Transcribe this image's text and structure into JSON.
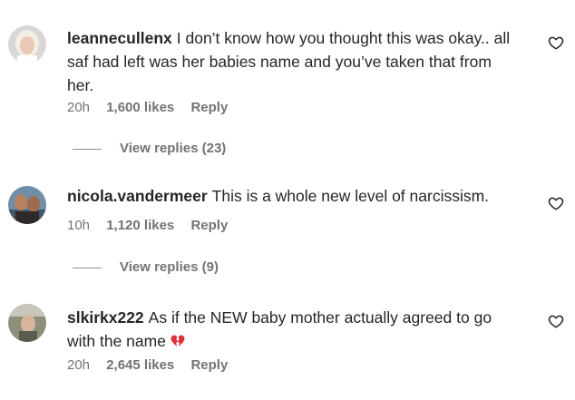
{
  "comments": [
    {
      "username": "leannecullenx",
      "text": "I don’t know how you thought this was okay.. all saf had left was her babies name and you’ve taken that from her.",
      "time": "20h",
      "likes": "1,600 likes",
      "reply_label": "Reply",
      "view_replies": "View replies (23)",
      "heart_icon": "heart-outline-icon"
    },
    {
      "username": "nicola.vandermeer",
      "text": "This is a whole new level of narcissism.",
      "time": "10h",
      "likes": "1,120 likes",
      "reply_label": "Reply",
      "view_replies": "View replies (9)",
      "heart_icon": "heart-outline-icon"
    },
    {
      "username": "slkirkx222",
      "text": "As if the NEW baby mother actually agreed to go with the name",
      "emoji": "broken-heart-icon",
      "time": "20h",
      "likes": "2,645 likes",
      "reply_label": "Reply",
      "heart_icon": "heart-outline-icon"
    }
  ],
  "colors": {
    "text": "#262626",
    "muted": "#737373",
    "broken_heart": "#e0303a"
  }
}
